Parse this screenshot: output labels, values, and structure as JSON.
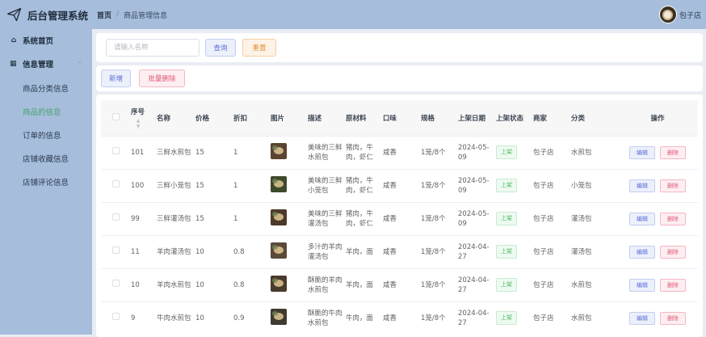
{
  "header": {
    "title": "后台管理系统",
    "breadcrumb_home": "首页",
    "breadcrumb_current": "商品管理信息",
    "user_name": "包子店",
    "colors": {
      "bar": "#a7bddc",
      "active_menu": "#47a36b"
    }
  },
  "sidebar": {
    "home": {
      "icon": "home-icon",
      "label": "系统首页"
    },
    "group": {
      "icon": "grid-icon",
      "label": "信息管理"
    },
    "items": [
      {
        "label": "商品分类信息",
        "active": false
      },
      {
        "label": "商品的信息",
        "active": true
      },
      {
        "label": "订单的信息",
        "active": false
      },
      {
        "label": "店铺收藏信息",
        "active": false
      },
      {
        "label": "店铺评论信息",
        "active": false
      }
    ]
  },
  "search": {
    "placeholder": "请输入名称",
    "value": "",
    "query_label": "查询",
    "reset_label": "重置"
  },
  "ops": {
    "add_label": "新增",
    "bulk_delete_label": "批量删除"
  },
  "table": {
    "headers": {
      "id": "序号",
      "name": "名称",
      "price": "价格",
      "discount": "折扣",
      "image": "图片",
      "desc": "描述",
      "ingredients": "原材料",
      "flavor": "口味",
      "spec": "规格",
      "date": "上架日期",
      "status": "上架状态",
      "shop": "商家",
      "category": "分类",
      "actions": "操作"
    },
    "edit_label": "编辑",
    "delete_label": "删除",
    "rows": [
      {
        "id": "101",
        "name": "三鲜水煎包",
        "price": "15",
        "discount": "1",
        "desc": "美味的三鲜水煎包",
        "ingredients": "猪肉，牛肉，虾仁",
        "flavor": "咸香",
        "spec": "1笼/8个",
        "date": "2024-05-09",
        "status": "上架",
        "shop": "包子店",
        "category": "水煎包"
      },
      {
        "id": "100",
        "name": "三鲜小笼包",
        "price": "15",
        "discount": "1",
        "desc": "美味的三鲜小笼包",
        "ingredients": "猪肉，牛肉，虾仁",
        "flavor": "咸香",
        "spec": "1笼/8个",
        "date": "2024-05-09",
        "status": "上架",
        "shop": "包子店",
        "category": "小笼包"
      },
      {
        "id": "99",
        "name": "三鲜灌汤包",
        "price": "15",
        "discount": "1",
        "desc": "美味的三鲜灌汤包",
        "ingredients": "猪肉，牛肉，虾仁",
        "flavor": "咸香",
        "spec": "1笼/8个",
        "date": "2024-05-09",
        "status": "上架",
        "shop": "包子店",
        "category": "灌汤包"
      },
      {
        "id": "11",
        "name": "羊肉灌汤包",
        "price": "10",
        "discount": "0.8",
        "desc": "多汁的羊肉灌汤包",
        "ingredients": "羊肉，面",
        "flavor": "咸香",
        "spec": "1笼/8个",
        "date": "2024-04-27",
        "status": "上架",
        "shop": "包子店",
        "category": "灌汤包"
      },
      {
        "id": "10",
        "name": "羊肉水煎包",
        "price": "10",
        "discount": "0.8",
        "desc": "酥脆的羊肉水煎包",
        "ingredients": "羊肉，面",
        "flavor": "咸香",
        "spec": "1笼/8个",
        "date": "2024-04-27",
        "status": "上架",
        "shop": "包子店",
        "category": "水煎包"
      },
      {
        "id": "9",
        "name": "牛肉水煎包",
        "price": "10",
        "discount": "0.9",
        "desc": "酥脆的牛肉水煎包",
        "ingredients": "牛肉，面",
        "flavor": "咸香",
        "spec": "1笼/8个",
        "date": "2024-04-27",
        "status": "上架",
        "shop": "包子店",
        "category": "水煎包"
      }
    ]
  }
}
